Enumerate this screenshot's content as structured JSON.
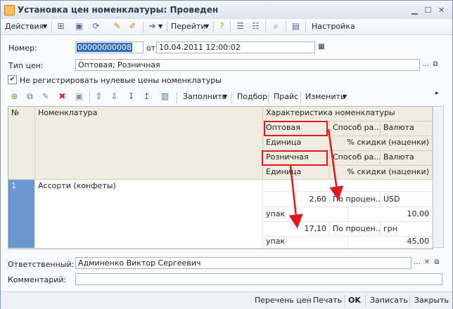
{
  "window": {
    "title": "Установка цен номенклатуры: Проведен"
  },
  "toolbar": {
    "actions_label": "Действия",
    "goto_label": "Перейти",
    "settings_label": "Настройка"
  },
  "form": {
    "number_label": "Номер:",
    "number_value": "00000000008",
    "date_label": "от:",
    "date_value": "10.04.2011 12:00:02",
    "price_type_label": "Тип цен:",
    "price_type_value": "Оптовая; Розничная",
    "checkbox_label": "Не регистрировать нулевые цены номенклатуры",
    "checkbox_checked": true,
    "responsible_label": "Ответственный:",
    "responsible_value": "Админенко Виктор Сергеевич",
    "comment_label": "Комментарий:",
    "comment_value": ""
  },
  "grid_toolbar": {
    "fill_label": "Заполнить",
    "select_label": "Подбор",
    "price_list_label": "Прайс",
    "change_label": "Изменить"
  },
  "table": {
    "headers": {
      "num": "№",
      "item": "Номенклатура",
      "characteristic": "Характеристика номенклатуры",
      "wholesale": "Оптовая",
      "method_1": "Способ ра...",
      "currency_1": "Валюта",
      "unit_1": "Единица",
      "discount_1": "% скидки (наценки)",
      "retail": "Розничная",
      "method_2": "Способ ра...",
      "currency_2": "Валюта",
      "unit_2": "Единица",
      "discount_2": "% скидки (наценки)"
    },
    "rows": [
      {
        "num": "1",
        "item": "Ассорти (конфеты)",
        "wholesale_price": "2,60",
        "wholesale_method": "По процен...",
        "wholesale_currency": "USD",
        "wholesale_unit": "упак",
        "wholesale_discount": "10,00",
        "retail_price": "17,10",
        "retail_method": "По процен...",
        "retail_currency": "грн",
        "retail_unit": "упак",
        "retail_discount": "45,00"
      }
    ]
  },
  "statusbar": {
    "price_list": "Перечень цен",
    "print": "Печать",
    "ok": "OK",
    "save": "Записать",
    "close": "Закрыть"
  },
  "colors": {
    "highlight": "#e2171b",
    "selected_row": "#6d97d1",
    "header_bg": "#f1ece0"
  }
}
